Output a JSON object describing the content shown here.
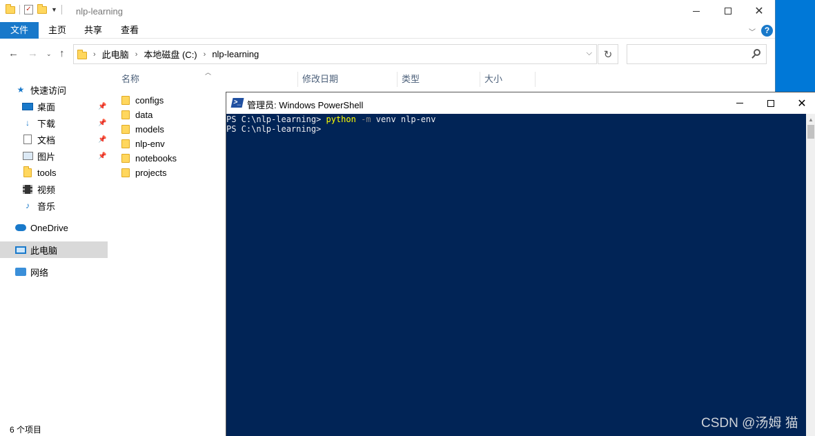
{
  "explorer": {
    "title": "nlp-learning",
    "ribbon_tabs": [
      "文件",
      "主页",
      "共享",
      "查看"
    ],
    "breadcrumb": [
      "此电脑",
      "本地磁盘 (C:)",
      "nlp-learning"
    ],
    "search_placeholder": "",
    "sidebar": {
      "quick_access": "快速访问",
      "items": [
        {
          "label": "桌面",
          "icon": "desktop-icon",
          "pinned": true
        },
        {
          "label": "下载",
          "icon": "download-icon",
          "pinned": true
        },
        {
          "label": "文档",
          "icon": "document-icon",
          "pinned": true
        },
        {
          "label": "图片",
          "icon": "picture-icon",
          "pinned": true
        },
        {
          "label": "tools",
          "icon": "folder-icon",
          "pinned": false
        },
        {
          "label": "视频",
          "icon": "video-icon",
          "pinned": false
        },
        {
          "label": "音乐",
          "icon": "music-icon",
          "pinned": false
        }
      ],
      "onedrive": "OneDrive",
      "this_pc": "此电脑",
      "network": "网络"
    },
    "columns": [
      "名称",
      "修改日期",
      "类型",
      "大小"
    ],
    "files": [
      "configs",
      "data",
      "models",
      "nlp-env",
      "notebooks",
      "projects"
    ],
    "status": "6 个项目"
  },
  "powershell": {
    "title": "管理员: Windows PowerShell",
    "lines": [
      {
        "prompt": "PS C:\\nlp-learning> ",
        "cmd": "python",
        "param": " -m",
        "args": " venv nlp-env"
      },
      {
        "prompt": "PS C:\\nlp-learning> ",
        "cmd": "",
        "param": "",
        "args": ""
      }
    ],
    "colors": {
      "background": "#012456",
      "command": "#ffff00",
      "parameter": "#808080",
      "text": "#eeedf0"
    }
  },
  "watermark": "CSDN @汤姆 猫"
}
